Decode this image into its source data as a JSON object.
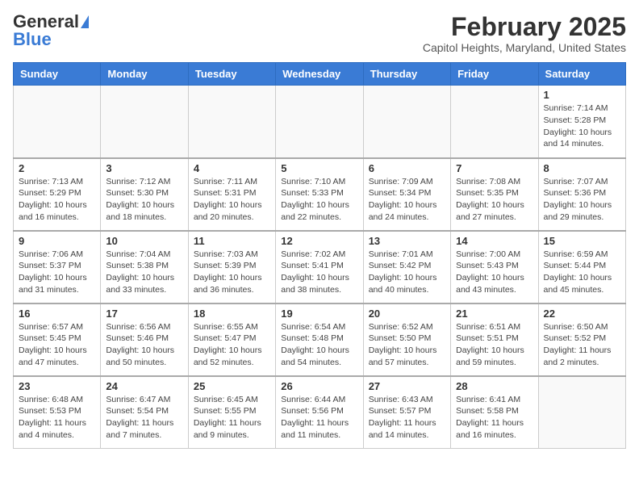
{
  "header": {
    "logo_general": "General",
    "logo_blue": "Blue",
    "title": "February 2025",
    "subtitle": "Capitol Heights, Maryland, United States"
  },
  "days_of_week": [
    "Sunday",
    "Monday",
    "Tuesday",
    "Wednesday",
    "Thursday",
    "Friday",
    "Saturday"
  ],
  "weeks": [
    [
      {
        "num": "",
        "info": ""
      },
      {
        "num": "",
        "info": ""
      },
      {
        "num": "",
        "info": ""
      },
      {
        "num": "",
        "info": ""
      },
      {
        "num": "",
        "info": ""
      },
      {
        "num": "",
        "info": ""
      },
      {
        "num": "1",
        "info": "Sunrise: 7:14 AM\nSunset: 5:28 PM\nDaylight: 10 hours and 14 minutes."
      }
    ],
    [
      {
        "num": "2",
        "info": "Sunrise: 7:13 AM\nSunset: 5:29 PM\nDaylight: 10 hours and 16 minutes."
      },
      {
        "num": "3",
        "info": "Sunrise: 7:12 AM\nSunset: 5:30 PM\nDaylight: 10 hours and 18 minutes."
      },
      {
        "num": "4",
        "info": "Sunrise: 7:11 AM\nSunset: 5:31 PM\nDaylight: 10 hours and 20 minutes."
      },
      {
        "num": "5",
        "info": "Sunrise: 7:10 AM\nSunset: 5:33 PM\nDaylight: 10 hours and 22 minutes."
      },
      {
        "num": "6",
        "info": "Sunrise: 7:09 AM\nSunset: 5:34 PM\nDaylight: 10 hours and 24 minutes."
      },
      {
        "num": "7",
        "info": "Sunrise: 7:08 AM\nSunset: 5:35 PM\nDaylight: 10 hours and 27 minutes."
      },
      {
        "num": "8",
        "info": "Sunrise: 7:07 AM\nSunset: 5:36 PM\nDaylight: 10 hours and 29 minutes."
      }
    ],
    [
      {
        "num": "9",
        "info": "Sunrise: 7:06 AM\nSunset: 5:37 PM\nDaylight: 10 hours and 31 minutes."
      },
      {
        "num": "10",
        "info": "Sunrise: 7:04 AM\nSunset: 5:38 PM\nDaylight: 10 hours and 33 minutes."
      },
      {
        "num": "11",
        "info": "Sunrise: 7:03 AM\nSunset: 5:39 PM\nDaylight: 10 hours and 36 minutes."
      },
      {
        "num": "12",
        "info": "Sunrise: 7:02 AM\nSunset: 5:41 PM\nDaylight: 10 hours and 38 minutes."
      },
      {
        "num": "13",
        "info": "Sunrise: 7:01 AM\nSunset: 5:42 PM\nDaylight: 10 hours and 40 minutes."
      },
      {
        "num": "14",
        "info": "Sunrise: 7:00 AM\nSunset: 5:43 PM\nDaylight: 10 hours and 43 minutes."
      },
      {
        "num": "15",
        "info": "Sunrise: 6:59 AM\nSunset: 5:44 PM\nDaylight: 10 hours and 45 minutes."
      }
    ],
    [
      {
        "num": "16",
        "info": "Sunrise: 6:57 AM\nSunset: 5:45 PM\nDaylight: 10 hours and 47 minutes."
      },
      {
        "num": "17",
        "info": "Sunrise: 6:56 AM\nSunset: 5:46 PM\nDaylight: 10 hours and 50 minutes."
      },
      {
        "num": "18",
        "info": "Sunrise: 6:55 AM\nSunset: 5:47 PM\nDaylight: 10 hours and 52 minutes."
      },
      {
        "num": "19",
        "info": "Sunrise: 6:54 AM\nSunset: 5:48 PM\nDaylight: 10 hours and 54 minutes."
      },
      {
        "num": "20",
        "info": "Sunrise: 6:52 AM\nSunset: 5:50 PM\nDaylight: 10 hours and 57 minutes."
      },
      {
        "num": "21",
        "info": "Sunrise: 6:51 AM\nSunset: 5:51 PM\nDaylight: 10 hours and 59 minutes."
      },
      {
        "num": "22",
        "info": "Sunrise: 6:50 AM\nSunset: 5:52 PM\nDaylight: 11 hours and 2 minutes."
      }
    ],
    [
      {
        "num": "23",
        "info": "Sunrise: 6:48 AM\nSunset: 5:53 PM\nDaylight: 11 hours and 4 minutes."
      },
      {
        "num": "24",
        "info": "Sunrise: 6:47 AM\nSunset: 5:54 PM\nDaylight: 11 hours and 7 minutes."
      },
      {
        "num": "25",
        "info": "Sunrise: 6:45 AM\nSunset: 5:55 PM\nDaylight: 11 hours and 9 minutes."
      },
      {
        "num": "26",
        "info": "Sunrise: 6:44 AM\nSunset: 5:56 PM\nDaylight: 11 hours and 11 minutes."
      },
      {
        "num": "27",
        "info": "Sunrise: 6:43 AM\nSunset: 5:57 PM\nDaylight: 11 hours and 14 minutes."
      },
      {
        "num": "28",
        "info": "Sunrise: 6:41 AM\nSunset: 5:58 PM\nDaylight: 11 hours and 16 minutes."
      },
      {
        "num": "",
        "info": ""
      }
    ]
  ]
}
